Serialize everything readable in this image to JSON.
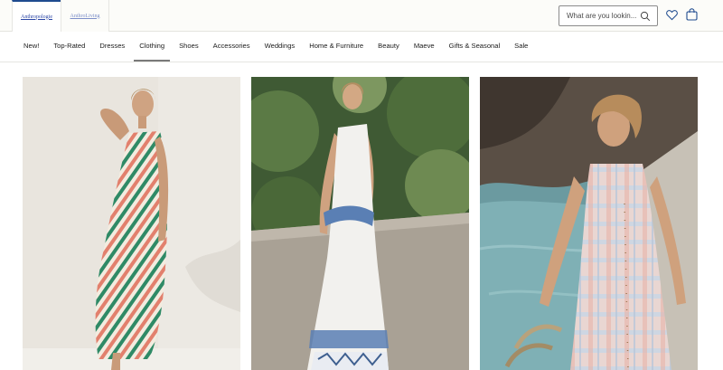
{
  "header": {
    "brands": [
      {
        "label": "Anthropologie",
        "active": true
      },
      {
        "label": "AnthroLiving",
        "active": false
      }
    ],
    "search": {
      "placeholder": "What are you lookin..."
    },
    "icons": {
      "search": "search-icon",
      "wishlist": "heart-icon",
      "bag": "shopping-bag-icon"
    }
  },
  "nav": {
    "items": [
      {
        "label": "New!"
      },
      {
        "label": "Top-Rated"
      },
      {
        "label": "Dresses"
      },
      {
        "label": "Clothing",
        "active": true
      },
      {
        "label": "Shoes"
      },
      {
        "label": "Accessories"
      },
      {
        "label": "Weddings"
      },
      {
        "label": "Home & Furniture"
      },
      {
        "label": "Beauty"
      },
      {
        "label": "Maeve"
      },
      {
        "label": "Gifts & Seasonal"
      },
      {
        "label": "Sale"
      }
    ]
  },
  "colors": {
    "header_bg": "#fcfcf9",
    "brand_link": "#2b46a6",
    "active_tab_border": "#1f4b8f",
    "text": "#1b1b1b"
  }
}
